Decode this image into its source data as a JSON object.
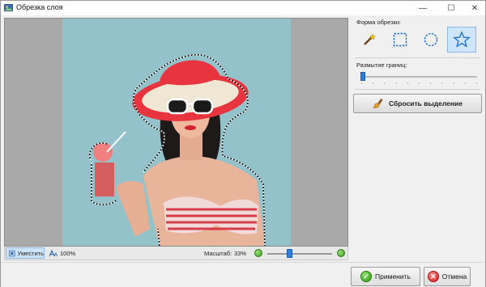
{
  "window": {
    "title": "Обрезка слоя"
  },
  "controls": {
    "minimize": "—",
    "maximize": "☐",
    "close": "✕"
  },
  "panel": {
    "shape_label": "Форма обрезки:",
    "shapes": [
      {
        "id": "magic-wand",
        "icon": "magic-wand-icon",
        "active": false
      },
      {
        "id": "rectangle",
        "icon": "rectangle-select-icon",
        "active": false
      },
      {
        "id": "ellipse",
        "icon": "ellipse-select-icon",
        "active": false
      },
      {
        "id": "star",
        "icon": "star-select-icon",
        "active": true
      }
    ],
    "blur_label": "Размытие границ:",
    "blur_value": 0,
    "reset_label": "Сбросить выделение"
  },
  "statusbar": {
    "fit_label": "Уместить",
    "zoom100_label": "100%",
    "scale_label": "Масштаб:",
    "scale_value": "33%",
    "scale_fraction": 0.33
  },
  "footer": {
    "apply_label": "Применить",
    "cancel_label": "Отмена"
  },
  "colors": {
    "accent": "#2f7fd6",
    "photo_background": "#93c2cb",
    "hat": "#e8343f",
    "ok_green": "#2f9a12",
    "cancel_red": "#d11b1b"
  }
}
